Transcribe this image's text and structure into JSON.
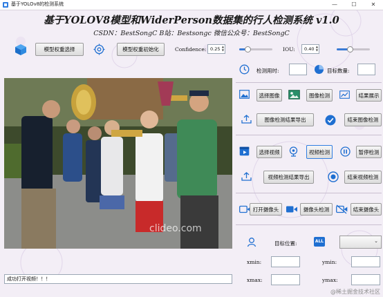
{
  "window": {
    "title": "基于YOLOv8的检测系统",
    "min": "—",
    "max": "☐",
    "close": "✕"
  },
  "header": {
    "title": "基于YOLOV8模型和WiderPerson数据集的行人检测系统 v1.0",
    "subtitle": "CSDN：BestSongC   B站：Bestsongc   微信公众号：BestSongC"
  },
  "toolbar": {
    "select_weights": "模型权重选择",
    "init_weights": "模型权重初始化",
    "confidence_label": "Confidence:",
    "confidence_value": "0.25",
    "confidence_slider": 0.25,
    "iou_label": "IOU:",
    "iou_value": "0.40",
    "iou_slider": 0.4
  },
  "stats": {
    "time_label": "检测用时:",
    "count_label": "目标数量:"
  },
  "image_section": {
    "select": "选择图像",
    "detect": "图像检测",
    "show_result": "结果展示",
    "export": "图像检测结果导出",
    "end": "结束图像检测"
  },
  "video_section": {
    "select": "选择视频",
    "detect": "视频检测",
    "pause": "暂停检测",
    "export": "视频检测结果导出",
    "end": "结束视频检测"
  },
  "camera_section": {
    "open": "打开摄像头",
    "detect": "摄像头检测",
    "end": "结束摄像头"
  },
  "target": {
    "position_label": "目标位置:",
    "combo_icon_text": "ALL",
    "combo_value": "",
    "xmin": "xmin:",
    "ymin": "ymin:",
    "xmax": "xmax:",
    "ymax": "ymax:"
  },
  "video": {
    "watermark": "clideo.com"
  },
  "status_bar": {
    "message": "成功打开视频！！！"
  },
  "page_watermark": "@稀土掘金技术社区",
  "colors": {
    "accent": "#1f6fd1",
    "panel_bg": "#f3eef6",
    "title_text": "#1a1a1a"
  }
}
